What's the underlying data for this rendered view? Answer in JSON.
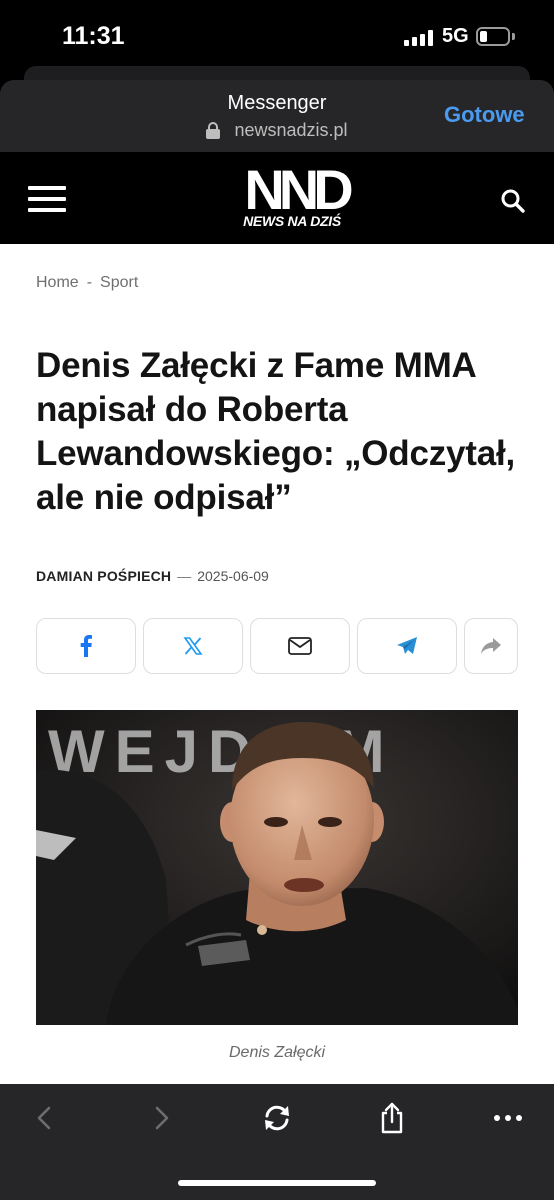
{
  "status_bar": {
    "time": "11:31",
    "network": "5G"
  },
  "browser": {
    "title": "Messenger",
    "url": "newsnadzis.pl",
    "done_label": "Gotowe"
  },
  "site": {
    "logo_text": "NND",
    "tagline": "NEWS NA DZIŚ"
  },
  "breadcrumb": {
    "home": "Home",
    "separator": "-",
    "section": "Sport"
  },
  "article": {
    "title": "Denis Załęcki z Fame MMA napisał do Roberta Lewandowskiego: „Odczytał, ale nie odpisał”",
    "author": "DAMIAN POŚPIECH",
    "date_separator": "—",
    "date": "2025-06-09",
    "image_caption": "Denis Załęcki"
  },
  "share_buttons": [
    {
      "icon": "facebook-icon",
      "color": "#1877f2"
    },
    {
      "icon": "x-icon",
      "color": "#1d9bf0"
    },
    {
      "icon": "mail-icon",
      "color": "#222222"
    },
    {
      "icon": "telegram-icon",
      "color": "#2a8fd6"
    },
    {
      "icon": "share-forward-icon",
      "color": "#9a9a9a"
    }
  ],
  "photo": {
    "backdrop_text": "WEJDZ M"
  },
  "toolbar": [
    "back-icon",
    "forward-icon",
    "reload-icon",
    "share-icon",
    "more-icon"
  ],
  "colors": {
    "accent": "#4a9bf0",
    "header_bg": "#000000",
    "toolbar_bg": "#262628"
  }
}
